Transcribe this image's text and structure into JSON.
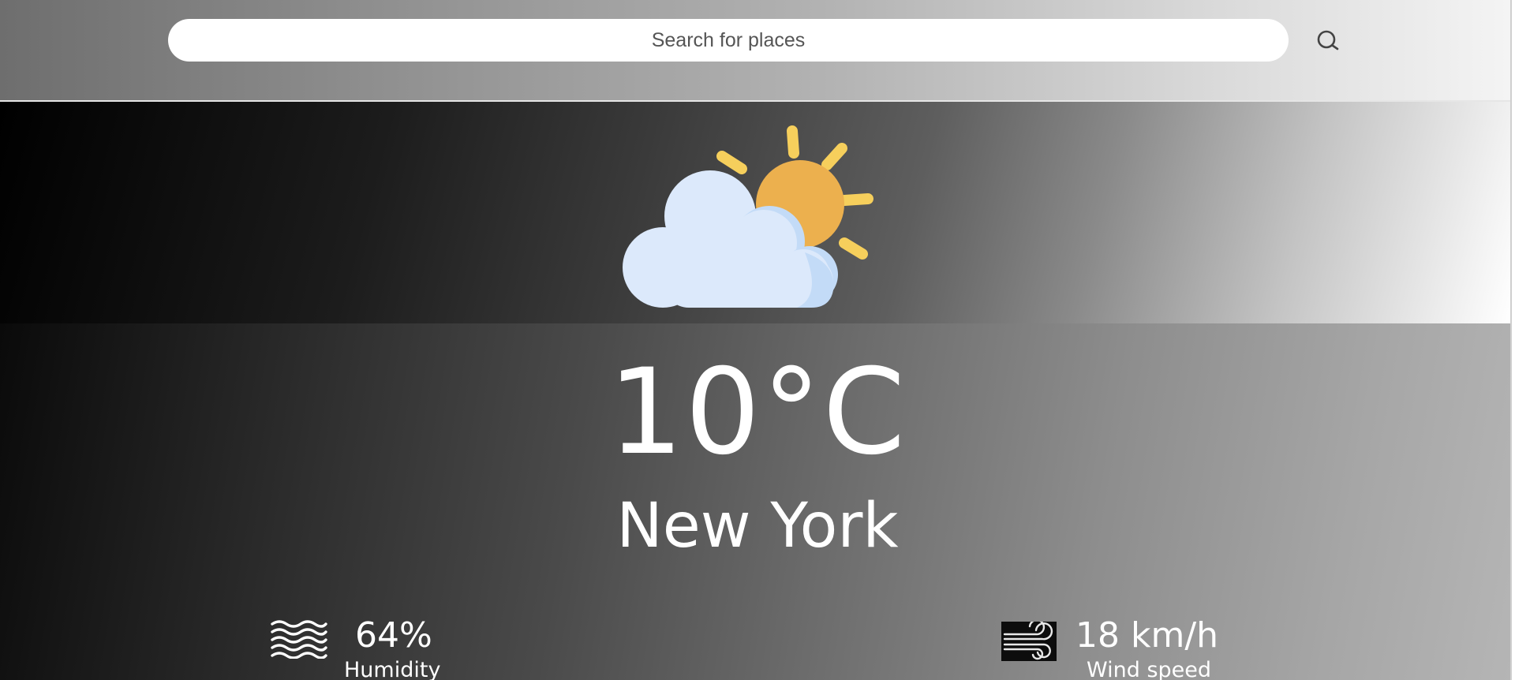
{
  "search": {
    "placeholder": "Search for places",
    "icon": "search-icon"
  },
  "weather": {
    "condition_icon": "partly-cloudy-icon",
    "temperature": "10°C",
    "city": "New York"
  },
  "humidity": {
    "icon": "humidity-waves-icon",
    "value": "64%",
    "label": "Humidity"
  },
  "wind": {
    "icon": "wind-icon",
    "value": "18 km/h",
    "label": "Wind speed"
  },
  "colors": {
    "sun": "#ecb04e",
    "sun_rays": "#f6cf5c",
    "cloud": "#dce9fb",
    "cloud_shade": "#c3dbf7",
    "text": "#ffffff"
  }
}
